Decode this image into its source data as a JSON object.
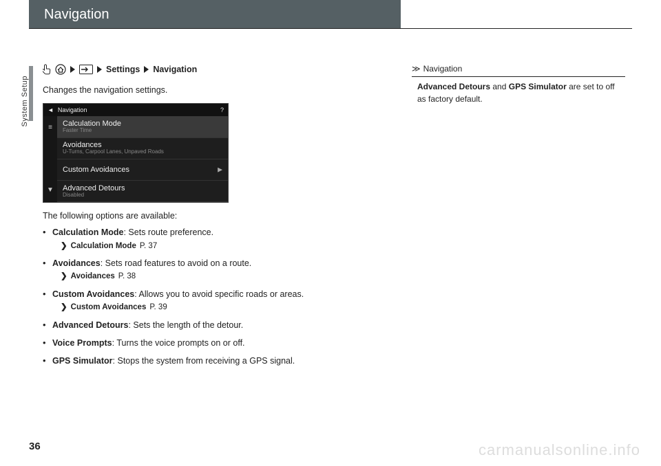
{
  "header": {
    "title": "Navigation"
  },
  "side": {
    "section": "System Setup"
  },
  "page_number": "36",
  "watermark": "carmanualsonline.info",
  "breadcrumb": {
    "step_settings": "Settings",
    "step_navigation": "Navigation"
  },
  "intro": "Changes the navigation settings.",
  "screenshot": {
    "title": "Navigation",
    "help": "?",
    "rows": [
      {
        "title": "Calculation Mode",
        "sub": "Faster Time"
      },
      {
        "title": "Avoidances",
        "sub": "U-Turns, Carpool Lanes, Unpaved Roads"
      },
      {
        "title": "Custom Avoidances",
        "sub": ""
      },
      {
        "title": "Advanced Detours",
        "sub": "Disabled"
      }
    ]
  },
  "options_intro": "The following options are available:",
  "options": [
    {
      "name": "Calculation Mode",
      "desc": ": Sets route preference.",
      "xref_label": "Calculation Mode",
      "xref_page": "P. 37"
    },
    {
      "name": "Avoidances",
      "desc": ": Sets road features to avoid on a route.",
      "xref_label": "Avoidances",
      "xref_page": "P. 38"
    },
    {
      "name": "Custom Avoidances",
      "desc": ": Allows you to avoid specific roads or areas.",
      "xref_label": "Custom Avoidances",
      "xref_page": "P. 39"
    },
    {
      "name": "Advanced Detours",
      "desc": ": Sets the length of the detour."
    },
    {
      "name": "Voice Prompts",
      "desc": ": Turns the voice prompts on or off."
    },
    {
      "name": "GPS Simulator",
      "desc": ": Stops the system from receiving a GPS signal."
    }
  ],
  "right": {
    "title": "Navigation",
    "body_bold1": "Advanced Detours",
    "body_mid": " and ",
    "body_bold2": "GPS Simulator",
    "body_tail": " are set to off as factory default."
  }
}
